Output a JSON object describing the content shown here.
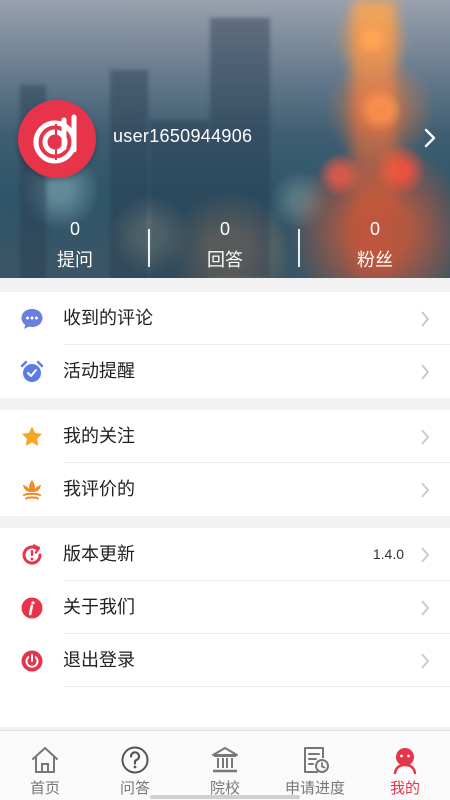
{
  "profile": {
    "username": "user1650944906",
    "stats": [
      {
        "count": "0",
        "label": "提问"
      },
      {
        "count": "0",
        "label": "回答"
      },
      {
        "count": "0",
        "label": "粉丝"
      }
    ]
  },
  "menu": {
    "group1": [
      {
        "label": "收到的评论",
        "icon": "comment-bubble-icon"
      },
      {
        "label": "活动提醒",
        "icon": "alarm-clock-icon"
      }
    ],
    "group2": [
      {
        "label": "我的关注",
        "icon": "star-icon"
      },
      {
        "label": "我评价的",
        "icon": "flower-icon"
      }
    ],
    "group3": [
      {
        "label": "版本更新",
        "icon": "update-icon",
        "value": "1.4.0"
      },
      {
        "label": "关于我们",
        "icon": "info-icon"
      },
      {
        "label": "退出登录",
        "icon": "power-icon"
      }
    ]
  },
  "tabs": [
    {
      "label": "首页",
      "icon": "home-icon"
    },
    {
      "label": "问答",
      "icon": "question-icon"
    },
    {
      "label": "院校",
      "icon": "school-icon"
    },
    {
      "label": "申请进度",
      "icon": "progress-icon"
    },
    {
      "label": "我的",
      "icon": "profile-icon",
      "active": true
    }
  ],
  "colors": {
    "accent": "#e8344a",
    "comment": "#6b7fe0",
    "alarm": "#5b7ce6",
    "star": "#f5a623",
    "flower": "#f08a24",
    "update": "#e8344a",
    "info": "#e8344a",
    "power": "#e8344a"
  }
}
